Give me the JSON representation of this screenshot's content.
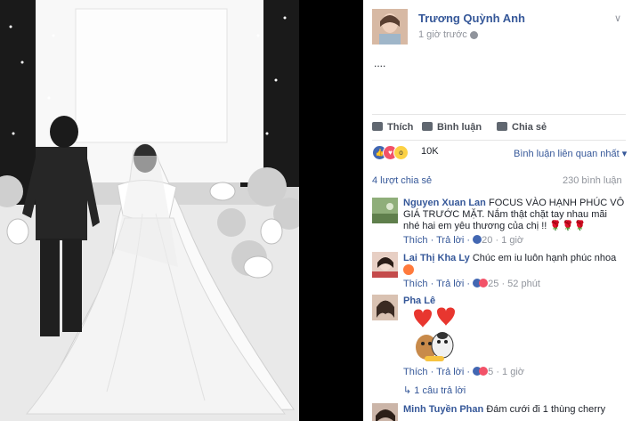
{
  "post": {
    "author": "Trương Quỳnh Anh",
    "time": "1 giờ trước",
    "text": "....",
    "actions": {
      "like": "Thích",
      "comment": "Bình luận",
      "share": "Chia sẻ"
    },
    "reaction_count": "10K",
    "sort_label": "Bình luận liên quan nhất",
    "shares": "4 lượt chia sẻ",
    "comment_count": "230 bình luận"
  },
  "comments": [
    {
      "name": "Nguyen Xuan Lan",
      "text": "FOCUS VÀO HẠNH PHÚC VÔ GIÁ TRƯỚC MẶT. Nắm thật chặt tay nhau mãi nhé hai em yêu thương của chị !!",
      "like": "Thích",
      "reply": "Trả lời",
      "reactions": "20",
      "time": "1 giờ"
    },
    {
      "name": "Lai Thị Kha Ly",
      "text": "Chúc em iu luôn hạnh phúc nhoa",
      "like": "Thích",
      "reply": "Trả lời",
      "reactions": "25",
      "time": "52 phút"
    },
    {
      "name": "Pha Lê",
      "text": "",
      "like": "Thích",
      "reply": "Trả lời",
      "reactions": "5",
      "time": "1 giờ",
      "replies": "1 câu trả lời"
    },
    {
      "name": "Minh Tuyền Phan",
      "text": "Đám cưới đi 1 thùng cherry"
    }
  ],
  "colors": {
    "link": "#365899",
    "like": "#4267b2",
    "love": "#f25268",
    "wow": "#fcd144"
  }
}
